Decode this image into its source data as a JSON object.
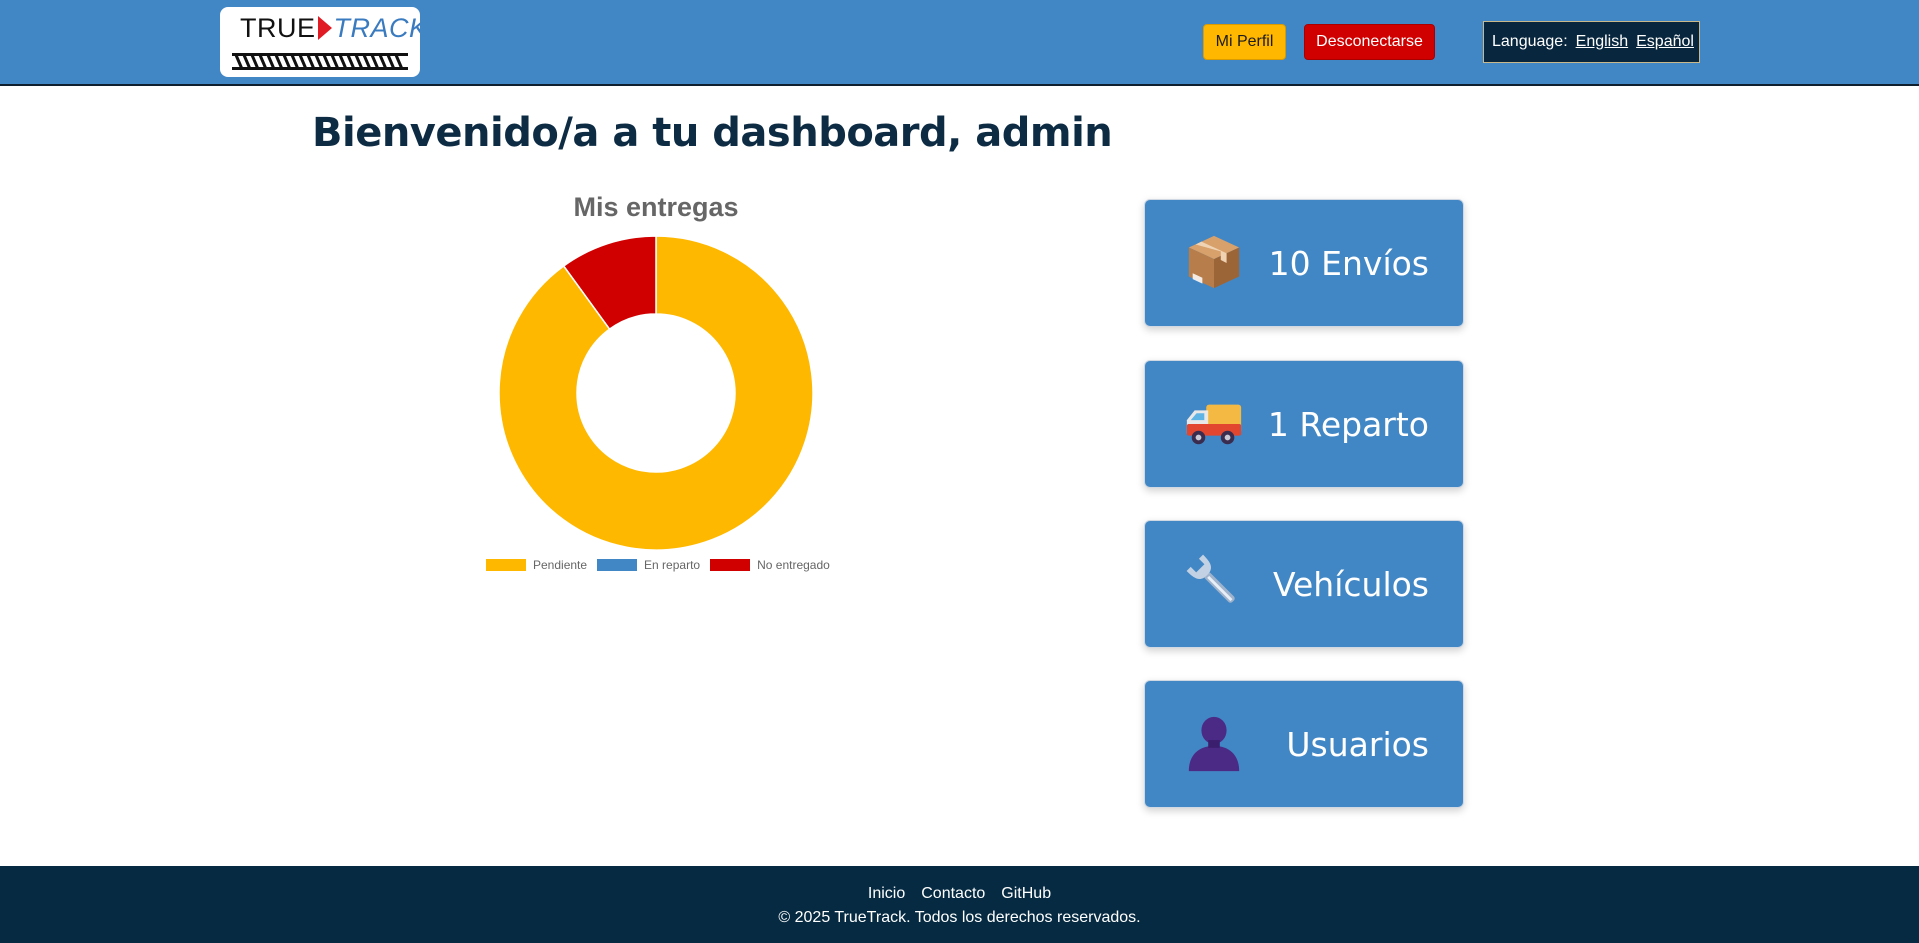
{
  "header": {
    "logo": {
      "true_text": "TRUE",
      "track_text": "TRACK"
    },
    "profile_button": "Mi Perfil",
    "logout_button": "Desconectarse",
    "language": {
      "label": "Language:",
      "options": [
        "English",
        "Español"
      ]
    },
    "colors": {
      "bar": "#4287c5",
      "profile": "#ffb700",
      "logout": "#d10000",
      "lang_box": "#08263d"
    }
  },
  "main": {
    "title": "Bienvenido/a a tu dashboard, admin"
  },
  "chart_data": {
    "type": "pie",
    "donut": true,
    "title": "Mis entregas",
    "categories": [
      "Pendiente",
      "En reparto",
      "No entregado"
    ],
    "values": [
      9,
      0,
      1
    ],
    "colors": [
      "#ffb800",
      "#4287c5",
      "#d10000"
    ],
    "legend": "bottom"
  },
  "cards": [
    {
      "icon": "package-icon",
      "label": "10 Envíos"
    },
    {
      "icon": "delivery-truck-icon",
      "label": "1 Reparto"
    },
    {
      "icon": "wrench-icon",
      "label": "Vehículos"
    },
    {
      "icon": "user-silhouette-icon",
      "label": "Usuarios"
    }
  ],
  "footer": {
    "links": [
      "Inicio",
      "Contacto",
      "GitHub"
    ],
    "copyright": "© 2025 TrueTrack. Todos los derechos reservados.",
    "background": "#052a41"
  }
}
